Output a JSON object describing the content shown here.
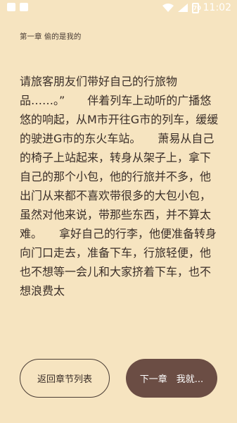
{
  "status_bar": {
    "time": "11:02",
    "battery_level": "70",
    "icons": [
      "notification-icon",
      "image-icon",
      "wifi-icon",
      "signal-icon",
      "battery-icon"
    ]
  },
  "chapter": {
    "title": "第一章 偷的是我的"
  },
  "content": {
    "text": "请旅客朋友们带好自己的行旅物品……。”　　伴着列车上动听的广播悠悠的响起，从M市开往G市的列车，缓缓的驶进G市的东火车站。　　萧易从自己的椅子上站起来，转身从架子上，拿下自己的那个小包，他的行旅并不多，他出门从来都不喜欢带很多的大包小包，虽然对他来说，带那些东西，并不算太难。　　拿好自己的行李，他便准备转身向门口走去，准备下车，行旅轻便，他也不想等一会儿和大家挤着下车，也不想浪费太"
  },
  "buttons": {
    "back_label": "返回章节列表",
    "next_label": "下一章　我就..."
  },
  "colors": {
    "background": "#f6e4c0",
    "text": "#3a2e28",
    "next_button": "#6b4d44"
  }
}
